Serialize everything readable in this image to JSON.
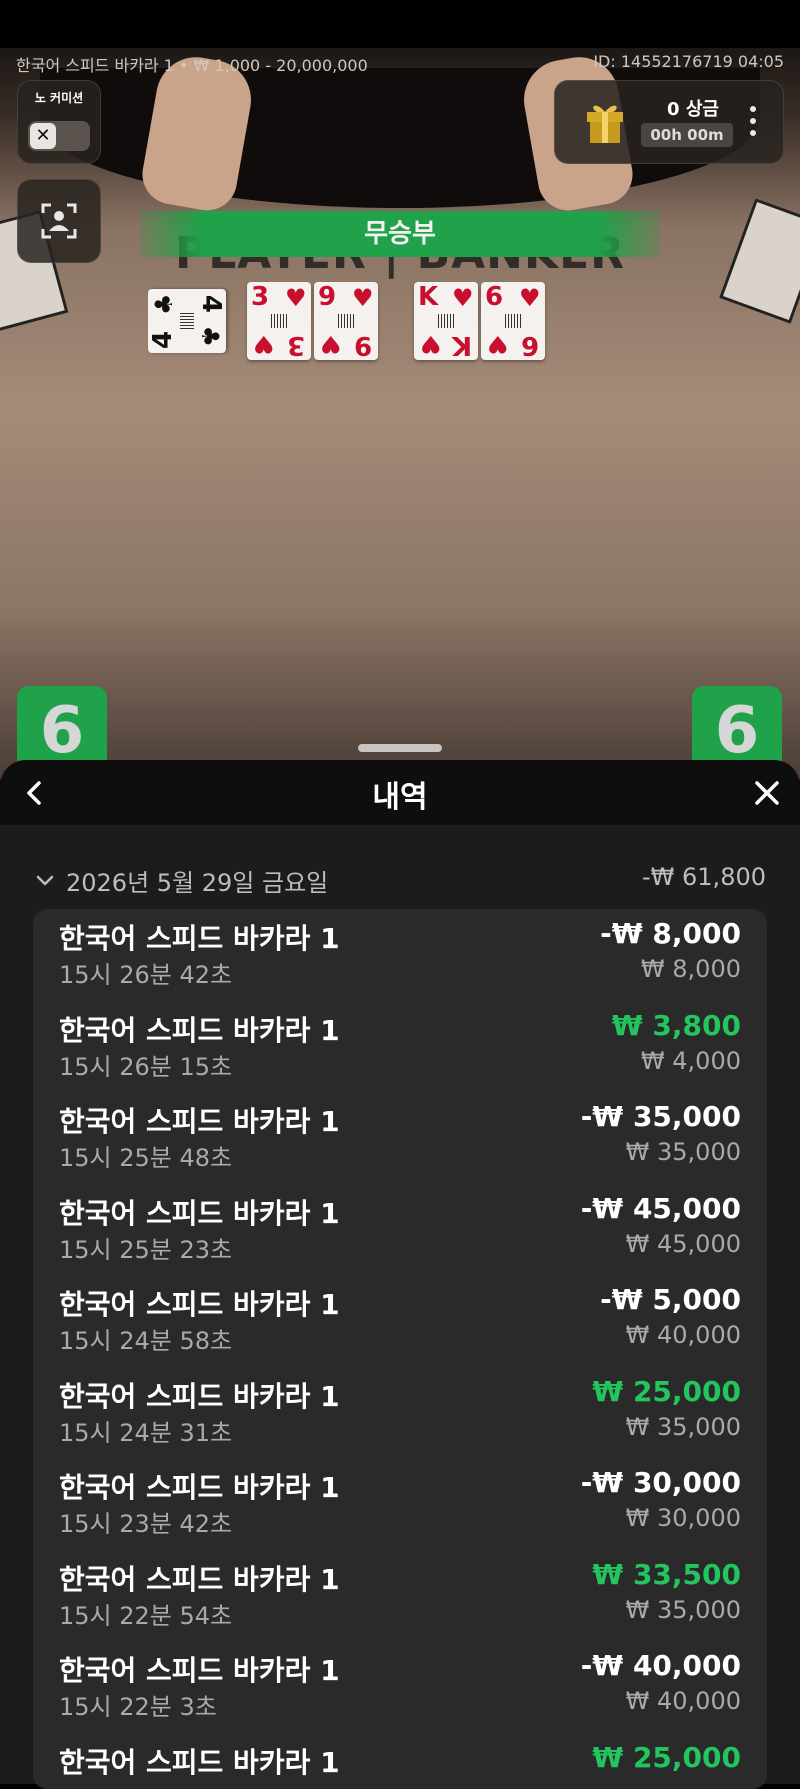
{
  "game": {
    "table_info": "한국어 스피드 바카라 1 • ₩ 1,000 - 20,000,000",
    "round_info": "ID: 14552176719 04:05",
    "no_commission_label": "노 커미션",
    "prize_count": "0 상금",
    "prize_timer": "00h 00m",
    "result_banner": "무승부",
    "table_words": "PLAYER | BANKER",
    "player_score": "6",
    "banker_score": "6",
    "player_cards": [
      {
        "rank": "4",
        "suit": "♣",
        "color": "#111111"
      },
      {
        "rank": "3",
        "suit": "♥",
        "color": "#c8102e"
      },
      {
        "rank": "9",
        "suit": "♥",
        "color": "#c8102e"
      }
    ],
    "banker_cards": [
      {
        "rank": "K",
        "suit": "♥",
        "color": "#c8102e"
      },
      {
        "rank": "6",
        "suit": "♥",
        "color": "#c8102e"
      }
    ]
  },
  "icons": {
    "close_toggle": "✕",
    "back": "chevron-left-icon",
    "close": "close-icon",
    "gift": "gift-icon",
    "more": "more-vertical-icon",
    "camera": "camera-view-icon"
  },
  "colors": {
    "win": "#22c55e",
    "tie_green": "#1fa24a",
    "panel_bg": "#1c1c1c"
  },
  "history": {
    "title": "내역",
    "date": "2026년 5월 29일 금요일",
    "date_total": "-₩ 61,800",
    "rows": [
      {
        "name": "한국어 스피드 바카라 1",
        "time": "15시 26분 42초",
        "result": "-₩ 8,000",
        "stake": "₩ 8,000",
        "win": false
      },
      {
        "name": "한국어 스피드 바카라 1",
        "time": "15시 26분 15초",
        "result": "₩ 3,800",
        "stake": "₩ 4,000",
        "win": true
      },
      {
        "name": "한국어 스피드 바카라 1",
        "time": "15시 25분 48초",
        "result": "-₩ 35,000",
        "stake": "₩ 35,000",
        "win": false
      },
      {
        "name": "한국어 스피드 바카라 1",
        "time": "15시 25분 23초",
        "result": "-₩ 45,000",
        "stake": "₩ 45,000",
        "win": false
      },
      {
        "name": "한국어 스피드 바카라 1",
        "time": "15시 24분 58초",
        "result": "-₩ 5,000",
        "stake": "₩ 40,000",
        "win": false
      },
      {
        "name": "한국어 스피드 바카라 1",
        "time": "15시 24분 31초",
        "result": "₩ 25,000",
        "stake": "₩ 35,000",
        "win": true
      },
      {
        "name": "한국어 스피드 바카라 1",
        "time": "15시 23분 42초",
        "result": "-₩ 30,000",
        "stake": "₩ 30,000",
        "win": false
      },
      {
        "name": "한국어 스피드 바카라 1",
        "time": "15시 22분 54초",
        "result": "₩ 33,500",
        "stake": "₩ 35,000",
        "win": true
      },
      {
        "name": "한국어 스피드 바카라 1",
        "time": "15시 22분 3초",
        "result": "-₩ 40,000",
        "stake": "₩ 40,000",
        "win": false
      },
      {
        "name": "한국어 스피드 바카라 1",
        "time": "",
        "result": "₩ 25,000",
        "stake": "",
        "win": true
      }
    ]
  }
}
